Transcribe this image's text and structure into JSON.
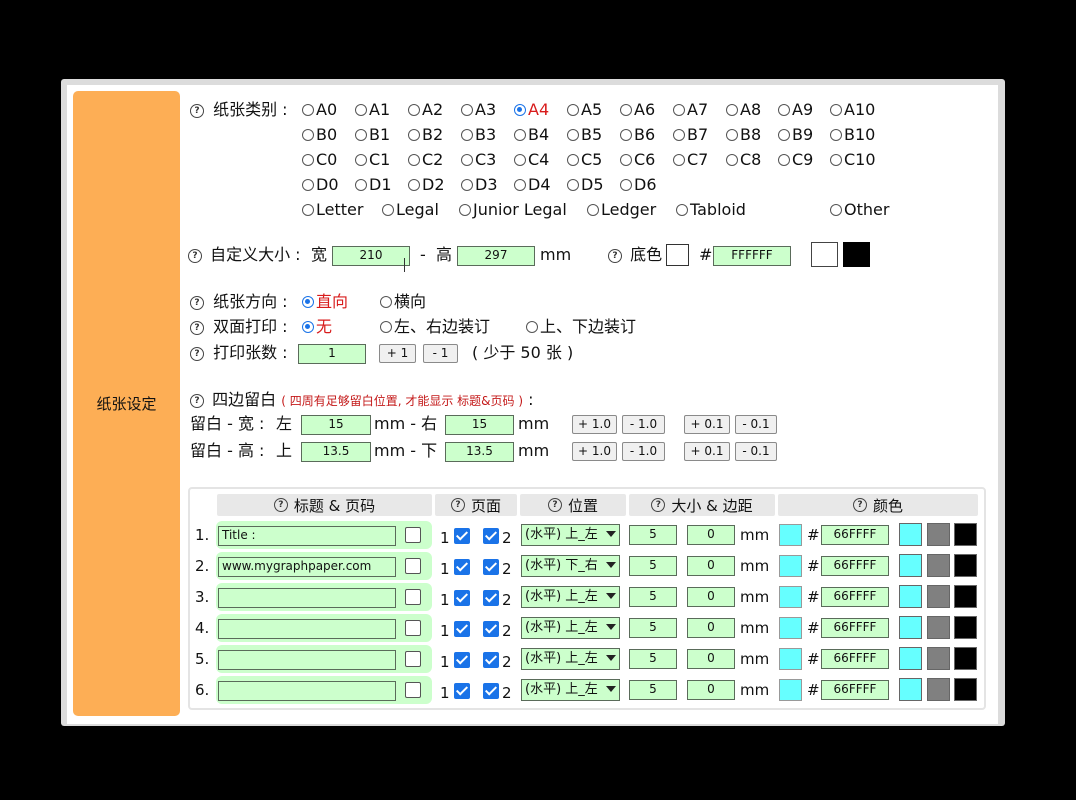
{
  "sidebar": {
    "label": "纸张设定"
  },
  "paper_type": {
    "label": "纸张类别 :",
    "rows": [
      [
        "A0",
        "A1",
        "A2",
        "A3",
        "A4",
        "A5",
        "A6",
        "A7",
        "A8",
        "A9",
        "A10"
      ],
      [
        "B0",
        "B1",
        "B2",
        "B3",
        "B4",
        "B5",
        "B6",
        "B7",
        "B8",
        "B9",
        "B10"
      ],
      [
        "C0",
        "C1",
        "C2",
        "C3",
        "C4",
        "C5",
        "C6",
        "C7",
        "C8",
        "C9",
        "C10"
      ],
      [
        "D0",
        "D1",
        "D2",
        "D3",
        "D4",
        "D5",
        "D6"
      ]
    ],
    "other_row": [
      "Letter",
      "Legal",
      "Junior Legal",
      "Ledger",
      "Tabloid",
      "Other"
    ],
    "selected": "A4"
  },
  "custom_size": {
    "label": "自定义大小 :",
    "width_label": "宽",
    "width_value": "210",
    "dash": "-",
    "height_label": "高",
    "height_value": "297",
    "unit": "mm",
    "bg_label": "底色",
    "hash": "#",
    "bg_value": "FFFFFF",
    "colors": {
      "bg_swatch": "#ffffff",
      "white": "#ffffff",
      "black": "#000000"
    }
  },
  "orientation": {
    "label": "纸张方向 :",
    "options": [
      "直向",
      "横向"
    ],
    "selected": "直向"
  },
  "duplex": {
    "label": "双面打印 :",
    "options": [
      "无",
      "左、右边装订",
      "上、下边装订"
    ],
    "selected": "无"
  },
  "copies": {
    "label": "打印张数 :",
    "value": "1",
    "plus": "+ 1",
    "minus": "- 1",
    "note": "( 少于 50 张 )"
  },
  "margins": {
    "title": "四边留白",
    "note": "( 四周有足够留白位置, 才能显示 标题&页码 )",
    "colon": ":",
    "width_row": {
      "label": "留白 - 宽 :",
      "left_label": "左",
      "left_value": "15",
      "mid": "mm - 右",
      "right_value": "15",
      "unit": "mm"
    },
    "height_row": {
      "label": "留白 - 高 :",
      "left_label": "上",
      "left_value": "13.5",
      "mid": "mm - 下",
      "right_value": "13.5",
      "unit": "mm"
    },
    "buttons": [
      "+ 1.0",
      "- 1.0",
      "+ 0.1",
      "- 0.1"
    ]
  },
  "table": {
    "headers": {
      "title": "标题 & 页码",
      "page": "页面",
      "position": "位置",
      "size": "大小 & 边距",
      "color": "颜色"
    },
    "page_labels": [
      "1",
      "2"
    ],
    "mm": "mm",
    "hash": "#",
    "rows": [
      {
        "num": "1.",
        "text": "Title :",
        "position": "(水平) 上_左",
        "size": "5",
        "margin": "0",
        "color": "66FFFF"
      },
      {
        "num": "2.",
        "text": "www.mygraphpaper.com",
        "position": "(水平) 下_右",
        "size": "5",
        "margin": "0",
        "color": "66FFFF"
      },
      {
        "num": "3.",
        "text": "",
        "position": "(水平) 上_左",
        "size": "5",
        "margin": "0",
        "color": "66FFFF"
      },
      {
        "num": "4.",
        "text": "",
        "position": "(水平) 上_左",
        "size": "5",
        "margin": "0",
        "color": "66FFFF"
      },
      {
        "num": "5.",
        "text": "",
        "position": "(水平) 上_左",
        "size": "5",
        "margin": "0",
        "color": "66FFFF"
      },
      {
        "num": "6.",
        "text": "",
        "position": "(水平) 上_左",
        "size": "5",
        "margin": "0",
        "color": "66FFFF"
      }
    ],
    "preset_colors": [
      "#66ffff",
      "#808080",
      "#000000"
    ],
    "swatch_color": "#66ffff"
  }
}
